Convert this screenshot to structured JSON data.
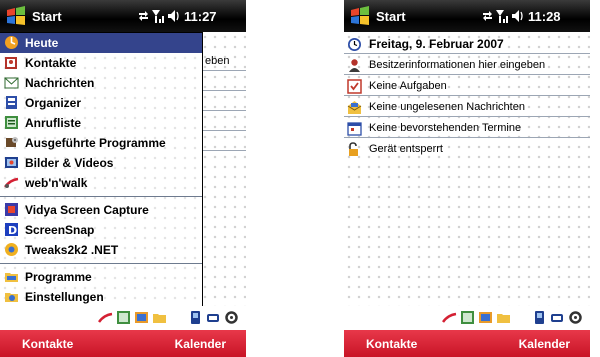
{
  "left_screen": {
    "start_label": "Start",
    "clock": "11:27",
    "behind_text": "eben",
    "start_menu": {
      "items": [
        {
          "label": "Heute",
          "icon": "today-icon",
          "selected": true
        },
        {
          "label": "Kontakte",
          "icon": "contacts-icon"
        },
        {
          "label": "Nachrichten",
          "icon": "messages-icon"
        },
        {
          "label": "Organizer",
          "icon": "organizer-icon"
        },
        {
          "label": "Anrufliste",
          "icon": "call-log-icon"
        },
        {
          "label": "Ausgeführte Programme",
          "icon": "running-programs-icon"
        },
        {
          "label": "Bilder & Videos",
          "icon": "pictures-videos-icon"
        },
        {
          "label": "web'n'walk",
          "icon": "web-n-walk-icon"
        }
      ],
      "recent": [
        {
          "label": "Vidya Screen Capture",
          "icon": "vidya-icon"
        },
        {
          "label": "ScreenSnap",
          "icon": "screensnap-icon"
        },
        {
          "label": "Tweaks2k2 .NET",
          "icon": "tweaks-icon"
        }
      ],
      "bottom": [
        {
          "label": "Programme",
          "icon": "programs-folder-icon"
        },
        {
          "label": "Einstellungen",
          "icon": "settings-folder-icon"
        }
      ]
    },
    "softkeys": {
      "left": "Kontakte",
      "right": "Kalender"
    }
  },
  "right_screen": {
    "start_label": "Start",
    "clock": "11:28",
    "today_items": [
      {
        "text": "Freitag, 9. Februar 2007",
        "icon": "clock-icon"
      },
      {
        "text": "Besitzerinformationen hier eingeben",
        "icon": "owner-icon"
      },
      {
        "text": "Keine Aufgaben",
        "icon": "tasks-icon"
      },
      {
        "text": "Keine ungelesenen Nachrichten",
        "icon": "mail-icon"
      },
      {
        "text": "Keine bevorstehenden Termine",
        "icon": "calendar-icon"
      },
      {
        "text": "Gerät entsperrt",
        "icon": "unlocked-icon"
      }
    ],
    "softkeys": {
      "left": "Kontakte",
      "right": "Kalender"
    }
  },
  "colors": {
    "menu_highlight": "#34448c",
    "softbar_red": "#d42033",
    "titlebar": "#000000"
  }
}
